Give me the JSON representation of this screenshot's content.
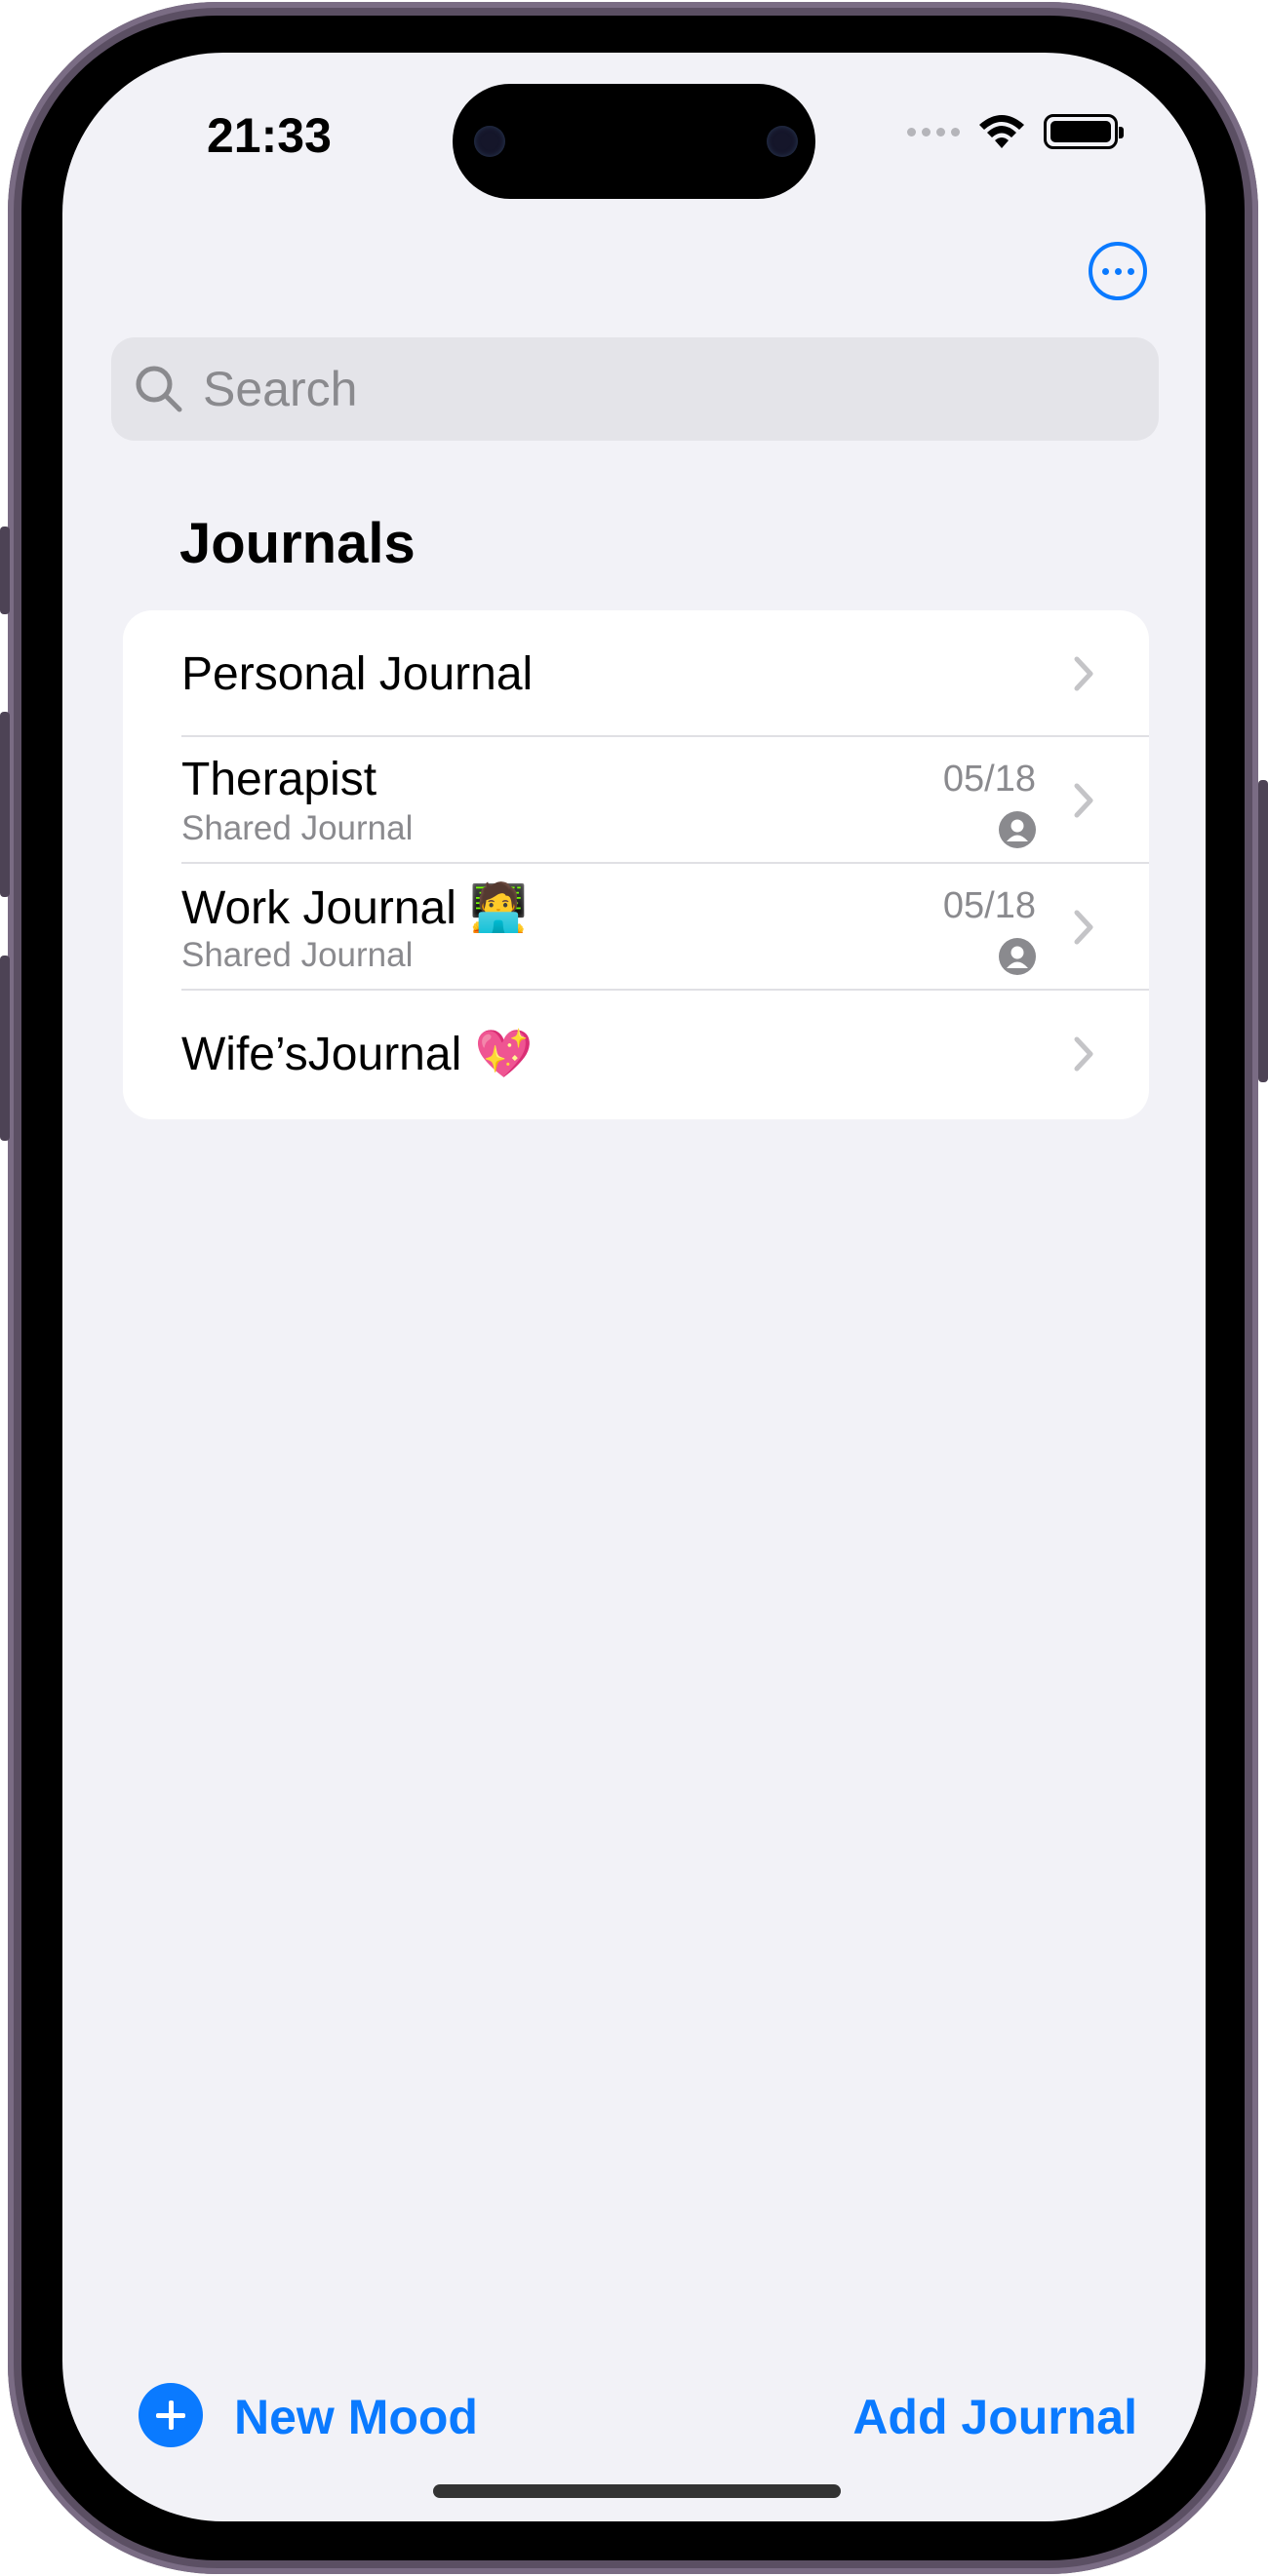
{
  "status_bar": {
    "time": "21:33"
  },
  "search": {
    "placeholder": "Search"
  },
  "section": {
    "title": "Journals"
  },
  "journals": [
    {
      "title": "Personal Journal"
    },
    {
      "title": "Therapist",
      "subtitle": "Shared Journal",
      "date": "05/18"
    },
    {
      "title": "Work Journal 🧑‍💻",
      "subtitle": "Shared Journal",
      "date": "05/18"
    },
    {
      "title": "Wife’sJournal 💖"
    }
  ],
  "toolbar": {
    "new_mood_label": "New Mood",
    "add_journal_label": "Add Journal"
  },
  "colors": {
    "accent": "#0a7aff",
    "background": "#f2f2f7"
  },
  "icons": [
    "search-icon",
    "more-icon",
    "chevron-right-icon",
    "person-icon",
    "plus-circle-icon",
    "wifi-icon",
    "battery-icon",
    "signal-icon"
  ]
}
